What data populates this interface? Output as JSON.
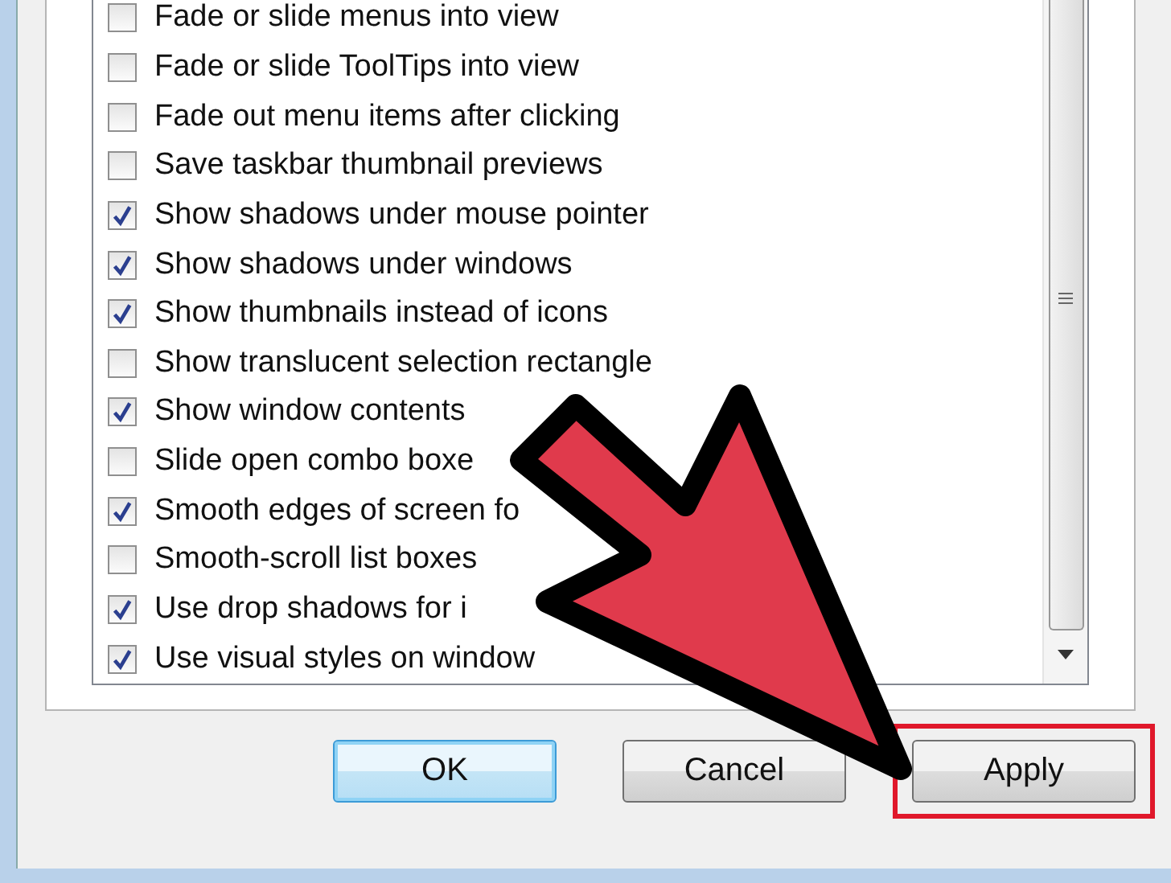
{
  "options": [
    {
      "label": "Fade or slide menus into view",
      "checked": false
    },
    {
      "label": "Fade or slide ToolTips into view",
      "checked": false
    },
    {
      "label": "Fade out menu items after clicking",
      "checked": false
    },
    {
      "label": "Save taskbar thumbnail previews",
      "checked": false
    },
    {
      "label": "Show shadows under mouse pointer",
      "checked": true
    },
    {
      "label": "Show shadows under windows",
      "checked": true
    },
    {
      "label": "Show thumbnails instead of icons",
      "checked": true
    },
    {
      "label": "Show translucent selection rectangle",
      "checked": false
    },
    {
      "label": "Show window contents",
      "checked": true
    },
    {
      "label": "Slide open combo boxe",
      "checked": false
    },
    {
      "label": "Smooth edges of screen fo",
      "checked": true
    },
    {
      "label": "Smooth-scroll list boxes",
      "checked": false
    },
    {
      "label": "Use drop shadows for i",
      "checked": true
    },
    {
      "label": "Use visual styles on window",
      "checked": true
    }
  ],
  "buttons": [
    {
      "label": "OK",
      "kind": "default",
      "highlighted": false
    },
    {
      "label": "Cancel",
      "kind": "normal",
      "highlighted": false
    },
    {
      "label": "Apply",
      "kind": "normal",
      "highlighted": true
    }
  ]
}
